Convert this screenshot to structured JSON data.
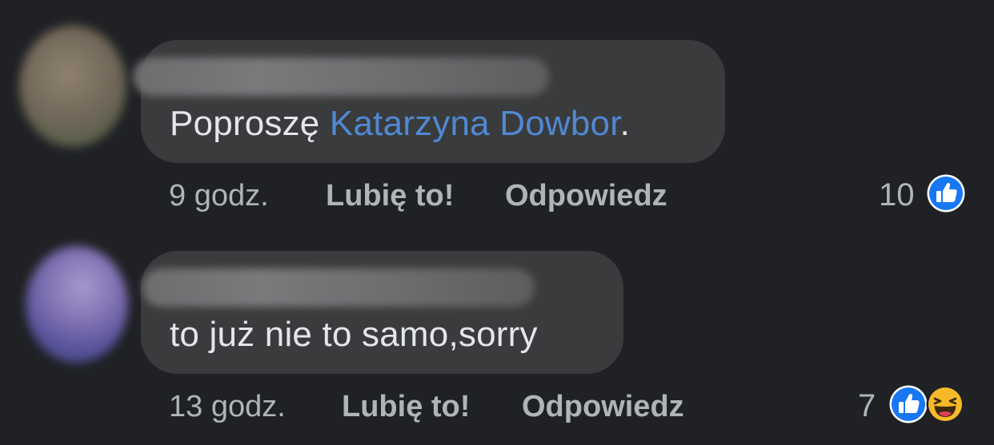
{
  "comments": [
    {
      "text_before": "Poproszę ",
      "mention": "Katarzyna Dowbor",
      "text_after": ".",
      "time": "9 godz.",
      "like_label": "Lubię to!",
      "reply_label": "Odpowiedz",
      "reaction_count": "10",
      "reactions": [
        "like-icon"
      ]
    },
    {
      "text": "to już nie to samo,sorry",
      "time": "13 godz.",
      "like_label": "Lubię to!",
      "reply_label": "Odpowiedz",
      "reaction_count": "7",
      "reactions": [
        "like-icon",
        "haha-icon"
      ]
    }
  ],
  "colors": {
    "background": "#1f2124",
    "bubble": "#3a3b3c",
    "text": "#e4e6eb",
    "meta": "#b0b3b8",
    "mention": "#4f89d3",
    "like": "#1877f2",
    "haha": "#f7b928"
  }
}
